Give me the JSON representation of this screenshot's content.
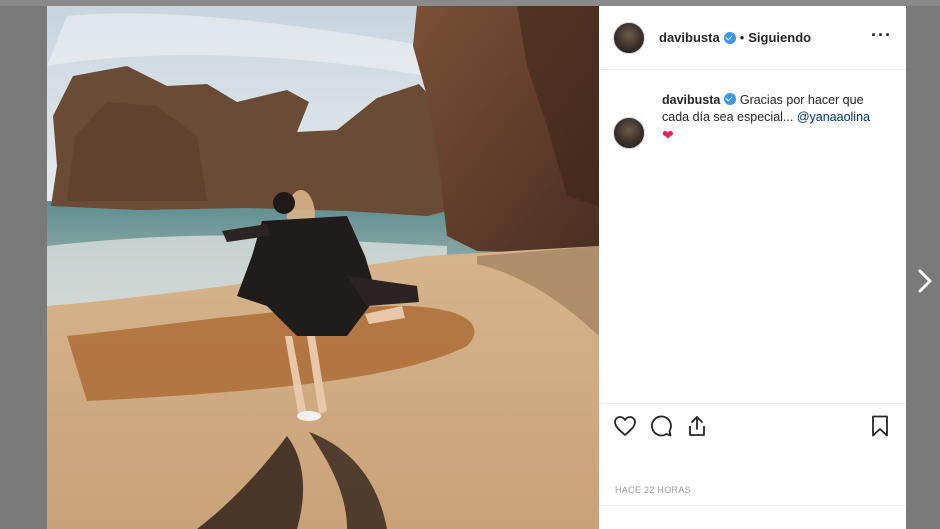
{
  "post": {
    "username": "davibusta",
    "separator": "•",
    "follow_status": "Siguiendo",
    "more_icon": "more-horizontal-icon",
    "caption": {
      "username": "davibusta",
      "text": "Gracias por hacer que cada día sea especial...",
      "mention": "@yanaaolina",
      "emoji": "❤"
    },
    "timestamp": "HACE 22 HORAS",
    "action_icons": [
      "heart-icon",
      "comment-icon",
      "share-icon",
      "bookmark-icon"
    ]
  },
  "colors": {
    "verified": "#3897f0",
    "mention": "#003569",
    "heart": "#e0245e",
    "text": "#262626",
    "muted": "#999999"
  },
  "navigation": {
    "next_icon": "chevron-right-icon"
  }
}
